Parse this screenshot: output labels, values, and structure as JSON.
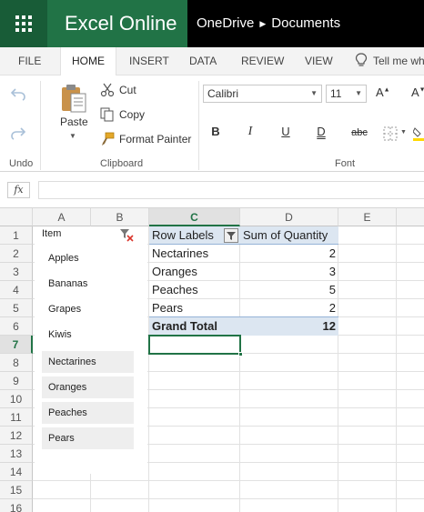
{
  "app": {
    "name": "Excel Online"
  },
  "breadcrumb": {
    "root": "OneDrive",
    "folder": "Documents"
  },
  "tabs": [
    {
      "label": "FILE"
    },
    {
      "label": "HOME"
    },
    {
      "label": "INSERT"
    },
    {
      "label": "DATA"
    },
    {
      "label": "REVIEW"
    },
    {
      "label": "VIEW"
    },
    {
      "label": "Tell me wh"
    }
  ],
  "ribbon": {
    "undo_group_label": "Undo",
    "paste_label": "Paste",
    "cut_label": "Cut",
    "copy_label": "Copy",
    "format_painter_label": "Format Painter",
    "clipboard_group_label": "Clipboard",
    "font_name": "Calibri",
    "font_size": "11",
    "font_group_label": "Font",
    "bold": "B",
    "italic": "I",
    "underline": "U",
    "double_underline": "D",
    "strikethrough": "abc"
  },
  "formula_bar": {
    "fx_label": "fx",
    "value": ""
  },
  "sheet": {
    "columns": [
      "A",
      "B",
      "C",
      "D",
      "E"
    ],
    "selected_column": "C",
    "rows": [
      "1",
      "2",
      "3",
      "4",
      "5",
      "6",
      "7",
      "8",
      "9",
      "10",
      "11",
      "12",
      "13",
      "14",
      "15",
      "16"
    ],
    "selected_row": "7",
    "pivot": {
      "header_labels": "Row Labels",
      "header_values": "Sum of Quantity",
      "rows": [
        {
          "label": "Nectarines",
          "value": "2"
        },
        {
          "label": "Oranges",
          "value": "3"
        },
        {
          "label": "Peaches",
          "value": "5"
        },
        {
          "label": "Pears",
          "value": "2"
        }
      ],
      "total_label": "Grand Total",
      "total_value": "12"
    }
  },
  "slicer": {
    "title": "Item",
    "items": [
      {
        "label": "Apples",
        "state": "on"
      },
      {
        "label": "Bananas",
        "state": "on"
      },
      {
        "label": "Grapes",
        "state": "on"
      },
      {
        "label": "Kiwis",
        "state": "on"
      },
      {
        "label": "Nectarines",
        "state": "off"
      },
      {
        "label": "Oranges",
        "state": "off"
      },
      {
        "label": "Peaches",
        "state": "off"
      },
      {
        "label": "Pears",
        "state": "off"
      }
    ]
  },
  "colors": {
    "brand": "#217346",
    "brand_dark": "#185c37",
    "pivot_header": "#dce6f1",
    "selection": "#217346"
  }
}
